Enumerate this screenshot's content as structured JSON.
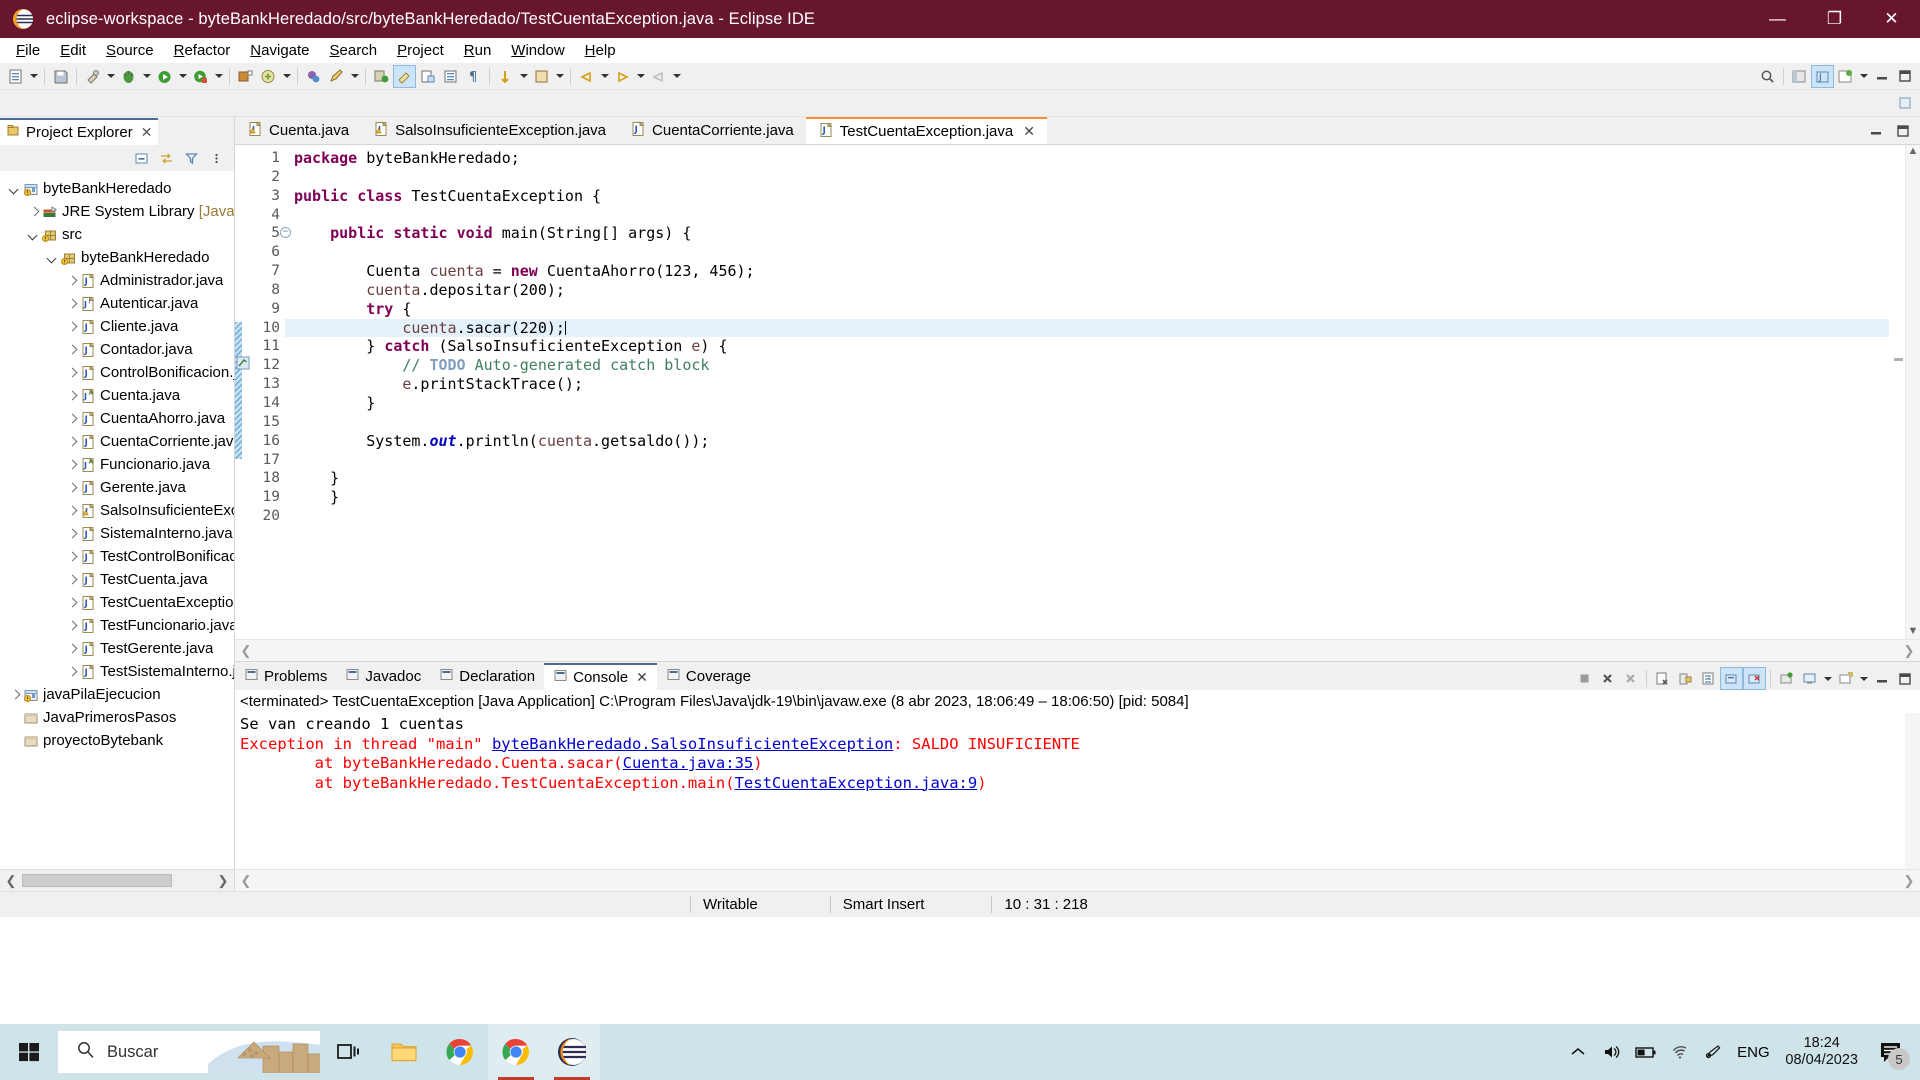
{
  "window": {
    "title": "eclipse-workspace - byteBankHeredado/src/byteBankHeredado/TestCuentaException.java - Eclipse IDE",
    "minimize": "—",
    "maximize": "❐",
    "close": "✕"
  },
  "menubar": [
    {
      "label": "File"
    },
    {
      "label": "Edit"
    },
    {
      "label": "Source"
    },
    {
      "label": "Refactor"
    },
    {
      "label": "Navigate"
    },
    {
      "label": "Search"
    },
    {
      "label": "Project"
    },
    {
      "label": "Run"
    },
    {
      "label": "Window"
    },
    {
      "label": "Help"
    }
  ],
  "explorer": {
    "tab_label": "Project Explorer",
    "close_glyph": "✕",
    "tree": [
      {
        "label": "byteBankHeredado",
        "indent": 0,
        "twist": "down",
        "icon": "java-project-icon"
      },
      {
        "label": "JRE System Library ",
        "dim": "[JavaSE-",
        "indent": 1,
        "twist": "right",
        "icon": "library-icon"
      },
      {
        "label": "src",
        "indent": 1,
        "twist": "down",
        "icon": "source-folder-icon"
      },
      {
        "label": "byteBankHeredado",
        "indent": 2,
        "twist": "down",
        "icon": "package-icon"
      },
      {
        "label": "Administrador.java",
        "indent": 3,
        "twist": "right",
        "icon": "java-file-icon"
      },
      {
        "label": "Autenticar.java",
        "indent": 3,
        "twist": "right",
        "icon": "java-interface-icon"
      },
      {
        "label": "Cliente.java",
        "indent": 3,
        "twist": "right",
        "icon": "java-file-icon"
      },
      {
        "label": "Contador.java",
        "indent": 3,
        "twist": "right",
        "icon": "java-file-icon"
      },
      {
        "label": "ControlBonificacion.j·",
        "indent": 3,
        "twist": "right",
        "icon": "java-file-icon"
      },
      {
        "label": "Cuenta.java",
        "indent": 3,
        "twist": "right",
        "icon": "java-abstract-icon"
      },
      {
        "label": "CuentaAhorro.java",
        "indent": 3,
        "twist": "right",
        "icon": "java-file-icon"
      },
      {
        "label": "CuentaCorriente.java",
        "indent": 3,
        "twist": "right",
        "icon": "java-file-icon"
      },
      {
        "label": "Funcionario.java",
        "indent": 3,
        "twist": "right",
        "icon": "java-abstract-icon"
      },
      {
        "label": "Gerente.java",
        "indent": 3,
        "twist": "right",
        "icon": "java-file-icon"
      },
      {
        "label": "SalsoInsuficienteExce",
        "indent": 3,
        "twist": "right",
        "icon": "java-warning-icon"
      },
      {
        "label": "SistemaInterno.java",
        "indent": 3,
        "twist": "right",
        "icon": "java-file-icon"
      },
      {
        "label": "TestControlBonificaci",
        "indent": 3,
        "twist": "right",
        "icon": "java-file-icon"
      },
      {
        "label": "TestCuenta.java",
        "indent": 3,
        "twist": "right",
        "icon": "java-file-icon"
      },
      {
        "label": "TestCuentaException.",
        "indent": 3,
        "twist": "right",
        "icon": "java-file-icon"
      },
      {
        "label": "TestFuncionario.java",
        "indent": 3,
        "twist": "right",
        "icon": "java-file-icon"
      },
      {
        "label": "TestGerente.java",
        "indent": 3,
        "twist": "right",
        "icon": "java-file-icon"
      },
      {
        "label": "TestSistemaInterno.ja",
        "indent": 3,
        "twist": "right",
        "icon": "java-file-icon"
      },
      {
        "label": "javaPilaEjecucion",
        "indent": 0,
        "twist": "right",
        "icon": "java-project-icon"
      },
      {
        "label": "JavaPrimerosPasos",
        "indent": 0,
        "twist": "none",
        "icon": "closed-project-icon"
      },
      {
        "label": "proyectoBytebank",
        "indent": 0,
        "twist": "none",
        "icon": "closed-project-icon"
      }
    ]
  },
  "editor": {
    "tabs": [
      {
        "label": "Cuenta.java",
        "active": false,
        "warn": true,
        "closable": false
      },
      {
        "label": "SalsoInsuficienteException.java",
        "active": false,
        "warn": true,
        "closable": false
      },
      {
        "label": "CuentaCorriente.java",
        "active": false,
        "warn": false,
        "closable": false
      },
      {
        "label": "TestCuentaException.java",
        "active": true,
        "warn": false,
        "closable": true
      }
    ],
    "close_glyph": "✕",
    "first_line": 1,
    "total_lines": 20,
    "highlight_line": 10,
    "lines": [
      {
        "n": 1,
        "html": "<span class=\"kw\">package</span> byteBankHeredado;"
      },
      {
        "n": 2,
        "html": ""
      },
      {
        "n": 3,
        "html": "<span class=\"kw\">public</span> <span class=\"kw\">class</span> TestCuentaException {"
      },
      {
        "n": 4,
        "html": ""
      },
      {
        "n": 5,
        "html": "    <span class=\"kw\">public</span> <span class=\"kw\">static</span> <span class=\"kw\">void</span> main(String[] args) {",
        "fold": true
      },
      {
        "n": 6,
        "html": ""
      },
      {
        "n": 7,
        "html": "        Cuenta <span class=\"lv\">cuenta</span> = <span class=\"kw\">new</span> CuentaAhorro(123, 456);"
      },
      {
        "n": 8,
        "html": "        <span class=\"lv\">cuenta</span>.depositar(200);"
      },
      {
        "n": 9,
        "html": "        <span class=\"kw\">try</span> {"
      },
      {
        "n": 10,
        "html": "            <span class=\"lv\">cuenta</span>.sacar(220);<span class=\"caret\"></span>"
      },
      {
        "n": 11,
        "html": "        } <span class=\"kw\">catch</span> (SalsoInsuficienteException <span class=\"lv\">e</span>) {"
      },
      {
        "n": 12,
        "html": "            <span class=\"cmt\">// </span><span class=\"todo\">TODO</span><span class=\"cmt\"> Auto-generated catch block</span>"
      },
      {
        "n": 13,
        "html": "            <span class=\"lv\">e</span>.printStackTrace();"
      },
      {
        "n": 14,
        "html": "        }"
      },
      {
        "n": 15,
        "html": ""
      },
      {
        "n": 16,
        "html": "        System.<span class=\"fld\">out</span>.println(<span class=\"lv\">cuenta</span>.getsaldo());"
      },
      {
        "n": 17,
        "html": ""
      },
      {
        "n": 18,
        "html": "    }"
      },
      {
        "n": 19,
        "html": "    }"
      },
      {
        "n": 20,
        "html": ""
      }
    ]
  },
  "bottom_panel": {
    "tabs": [
      {
        "label": "Problems",
        "icon": "problems-icon",
        "active": false,
        "closable": false
      },
      {
        "label": "Javadoc",
        "icon": "javadoc-icon",
        "active": false,
        "closable": false
      },
      {
        "label": "Declaration",
        "icon": "declaration-icon",
        "active": false,
        "closable": false
      },
      {
        "label": "Console",
        "icon": "console-icon",
        "active": true,
        "closable": true
      },
      {
        "label": "Coverage",
        "icon": "coverage-icon",
        "active": false,
        "closable": false
      }
    ],
    "close_glyph": "✕",
    "console_header": "<terminated> TestCuentaException [Java Application] C:\\Program Files\\Java\\jdk-19\\bin\\javaw.exe  (8 abr 2023, 18:06:49 – 18:06:50) [pid: 5084]",
    "console_lines": [
      {
        "segments": [
          {
            "text": "Se van creando 1 cuentas",
            "style": "plain"
          }
        ]
      },
      {
        "segments": [
          {
            "text": "Exception in thread \"main\" ",
            "style": "err"
          },
          {
            "text": "byteBankHeredado.SalsoInsuficienteException",
            "style": "link"
          },
          {
            "text": ": SALDO INSUFICIENTE",
            "style": "err"
          }
        ]
      },
      {
        "segments": [
          {
            "text": "\tat byteBankHeredado.Cuenta.sacar(",
            "style": "err"
          },
          {
            "text": "Cuenta.java:35",
            "style": "link"
          },
          {
            "text": ")",
            "style": "err"
          }
        ]
      },
      {
        "segments": [
          {
            "text": "\tat byteBankHeredado.TestCuentaException.main(",
            "style": "err"
          },
          {
            "text": "TestCuentaException.java:9",
            "style": "link"
          },
          {
            "text": ")",
            "style": "err"
          }
        ]
      }
    ]
  },
  "statusbar": {
    "writable": "Writable",
    "insert_mode": "Smart Insert",
    "position": "10 : 31 : 218"
  },
  "taskbar": {
    "search_placeholder": "Buscar",
    "language": "ENG",
    "time": "18:24",
    "date": "08/04/2023",
    "notification_count": "5",
    "apps": [
      {
        "name": "task-view-icon"
      },
      {
        "name": "file-explorer-icon"
      },
      {
        "name": "chrome-icon"
      },
      {
        "name": "chrome-beta-icon"
      },
      {
        "name": "eclipse-icon"
      }
    ]
  },
  "colors": {
    "titlebar": "#68152e",
    "keyword": "#7f0055",
    "comment": "#3f7f5f",
    "error": "#ff0000",
    "link": "#0000d0",
    "highlight_line": "#e4f0fa",
    "taskbar": "#cfe4e8"
  }
}
